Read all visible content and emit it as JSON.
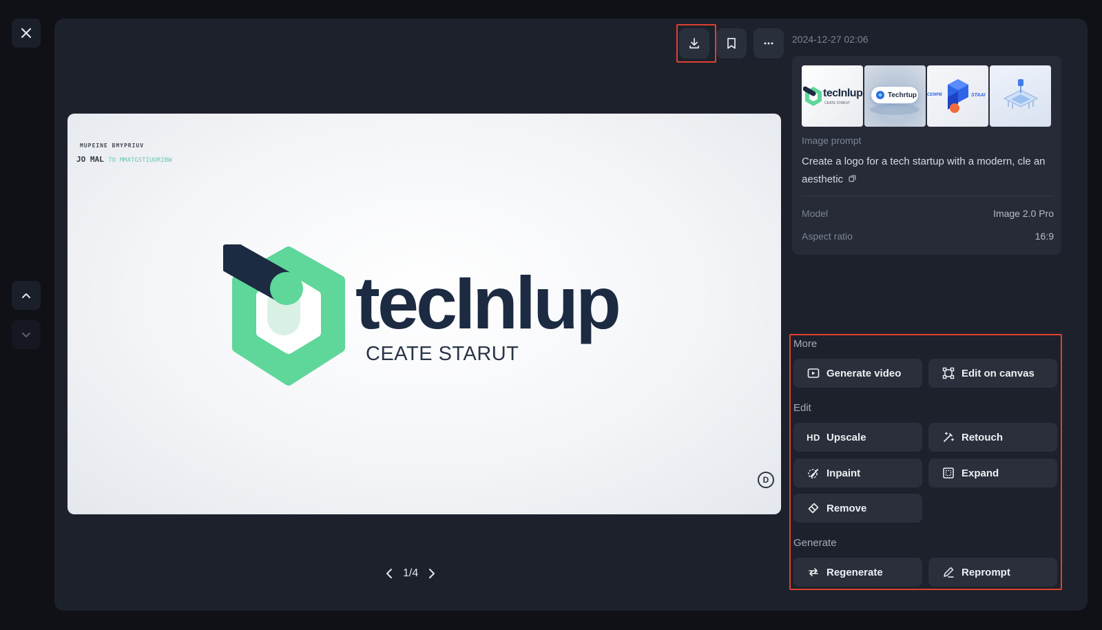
{
  "window": {
    "close_icon": "close-icon",
    "nav_up_icon": "chevron-up-icon",
    "nav_down_icon": "chevron-down-icon"
  },
  "toolbar": {
    "download_icon": "download-icon",
    "bookmark_icon": "bookmark-icon",
    "more_icon": "more-horizontal-icon"
  },
  "preview": {
    "small_text_1": "MUPEINE  BMYPRIUV",
    "small_text_2a": "JO MAL",
    "small_text_2b": "TO MMATGSTIUORIBW",
    "logo_word": "tecInlup",
    "logo_subtitle": "CEATE STARUT",
    "watermark_glyph": "D"
  },
  "pager": {
    "label": "1/4"
  },
  "details": {
    "timestamp": "2024-12-27 02:06",
    "thumbnails": [
      {
        "label": "tecInlup",
        "sub": "CEATE STARUT"
      },
      {
        "label": "Techrtup"
      },
      {
        "label_left": "CEMPB",
        "label_right": "STAAI"
      },
      {
        "label": ""
      }
    ],
    "prompt_label": "Image prompt",
    "prompt_text": "Create a logo for a tech startup with a modern, cle an aesthetic",
    "copy_icon": "copy-icon",
    "model_label": "Model",
    "model_value": "Image 2.0 Pro",
    "aspect_label": "Aspect ratio",
    "aspect_value": "16:9"
  },
  "tools": {
    "more_label": "More",
    "generate_video": "Generate video",
    "edit_on_canvas": "Edit on canvas",
    "edit_label": "Edit",
    "hd_badge": "HD",
    "upscale": "Upscale",
    "retouch": "Retouch",
    "inpaint": "Inpaint",
    "expand": "Expand",
    "remove": "Remove",
    "generate_label": "Generate",
    "regenerate": "Regenerate",
    "reprompt": "Reprompt"
  },
  "colors": {
    "accent_highlight": "#e0402f",
    "logo_green": "#5fd69a",
    "logo_navy": "#1c2a42"
  }
}
